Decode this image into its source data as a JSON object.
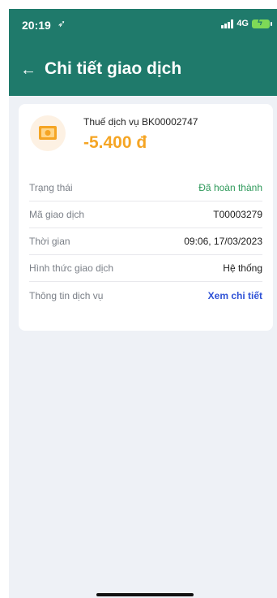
{
  "status_bar": {
    "time": "20:19",
    "location_glyph": "➶",
    "network": "4G"
  },
  "header": {
    "back_glyph": "←",
    "title": "Chi tiết giao dịch"
  },
  "transaction": {
    "icon": "money-icon",
    "description": "Thuế dịch vụ BK00002747",
    "amount": "-5.400 đ",
    "rows": [
      {
        "label": "Trạng thái",
        "value": "Đã hoàn thành"
      },
      {
        "label": "Mã giao dịch",
        "value": "T00003279"
      },
      {
        "label": "Thời gian",
        "value": "09:06, 17/03/2023"
      },
      {
        "label": "Hình thức giao dịch",
        "value": "Hệ thống"
      },
      {
        "label": "Thông tin dịch vụ",
        "value": "Xem chi tiết"
      }
    ]
  },
  "colors": {
    "header_bg": "#1f7a6b",
    "amount": "#f5a524",
    "status_done": "#2f9a5b",
    "link": "#2f52d6"
  }
}
